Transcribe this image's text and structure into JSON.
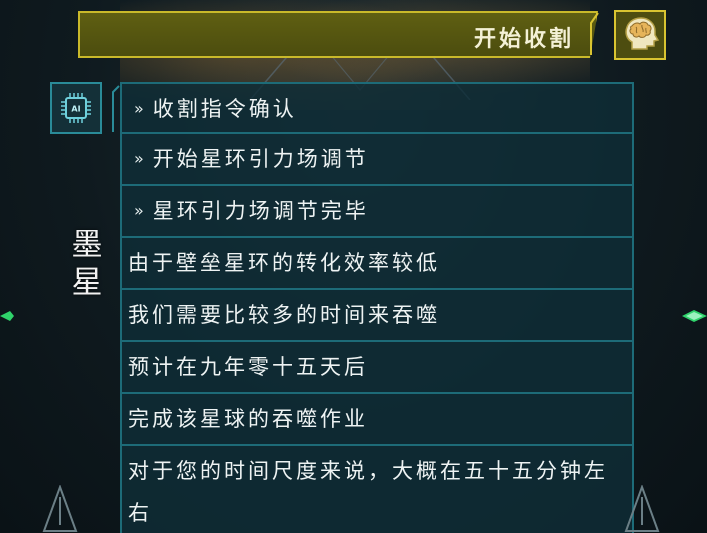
{
  "header": {
    "title": "开始收割",
    "brain_icon": "brain-head-icon",
    "accent_color": "#c9b92a"
  },
  "ai_panel": {
    "chip_icon": "ai-chip-icon",
    "chip_label": "AI"
  },
  "speaker": {
    "name": "墨星"
  },
  "dialog": {
    "lines": [
      {
        "prefix": "»",
        "text": "收割指令确认"
      },
      {
        "prefix": "»",
        "text": "开始星环引力场调节"
      },
      {
        "prefix": "»",
        "text": "星环引力场调节完毕"
      },
      {
        "text": "由于壁垒星环的转化效率较低"
      },
      {
        "text": "我们需要比较多的时间来吞噬"
      },
      {
        "text": "预计在九年零十五天后"
      },
      {
        "text": "完成该星球的吞噬作业"
      },
      {
        "text": "对于您的时间尺度来说，大概在五十五分钟左右"
      }
    ]
  },
  "theme": {
    "panel_border": "#1d6b78",
    "panel_bg": "#0f2d37",
    "nav_arrow": "#2fd36b"
  }
}
